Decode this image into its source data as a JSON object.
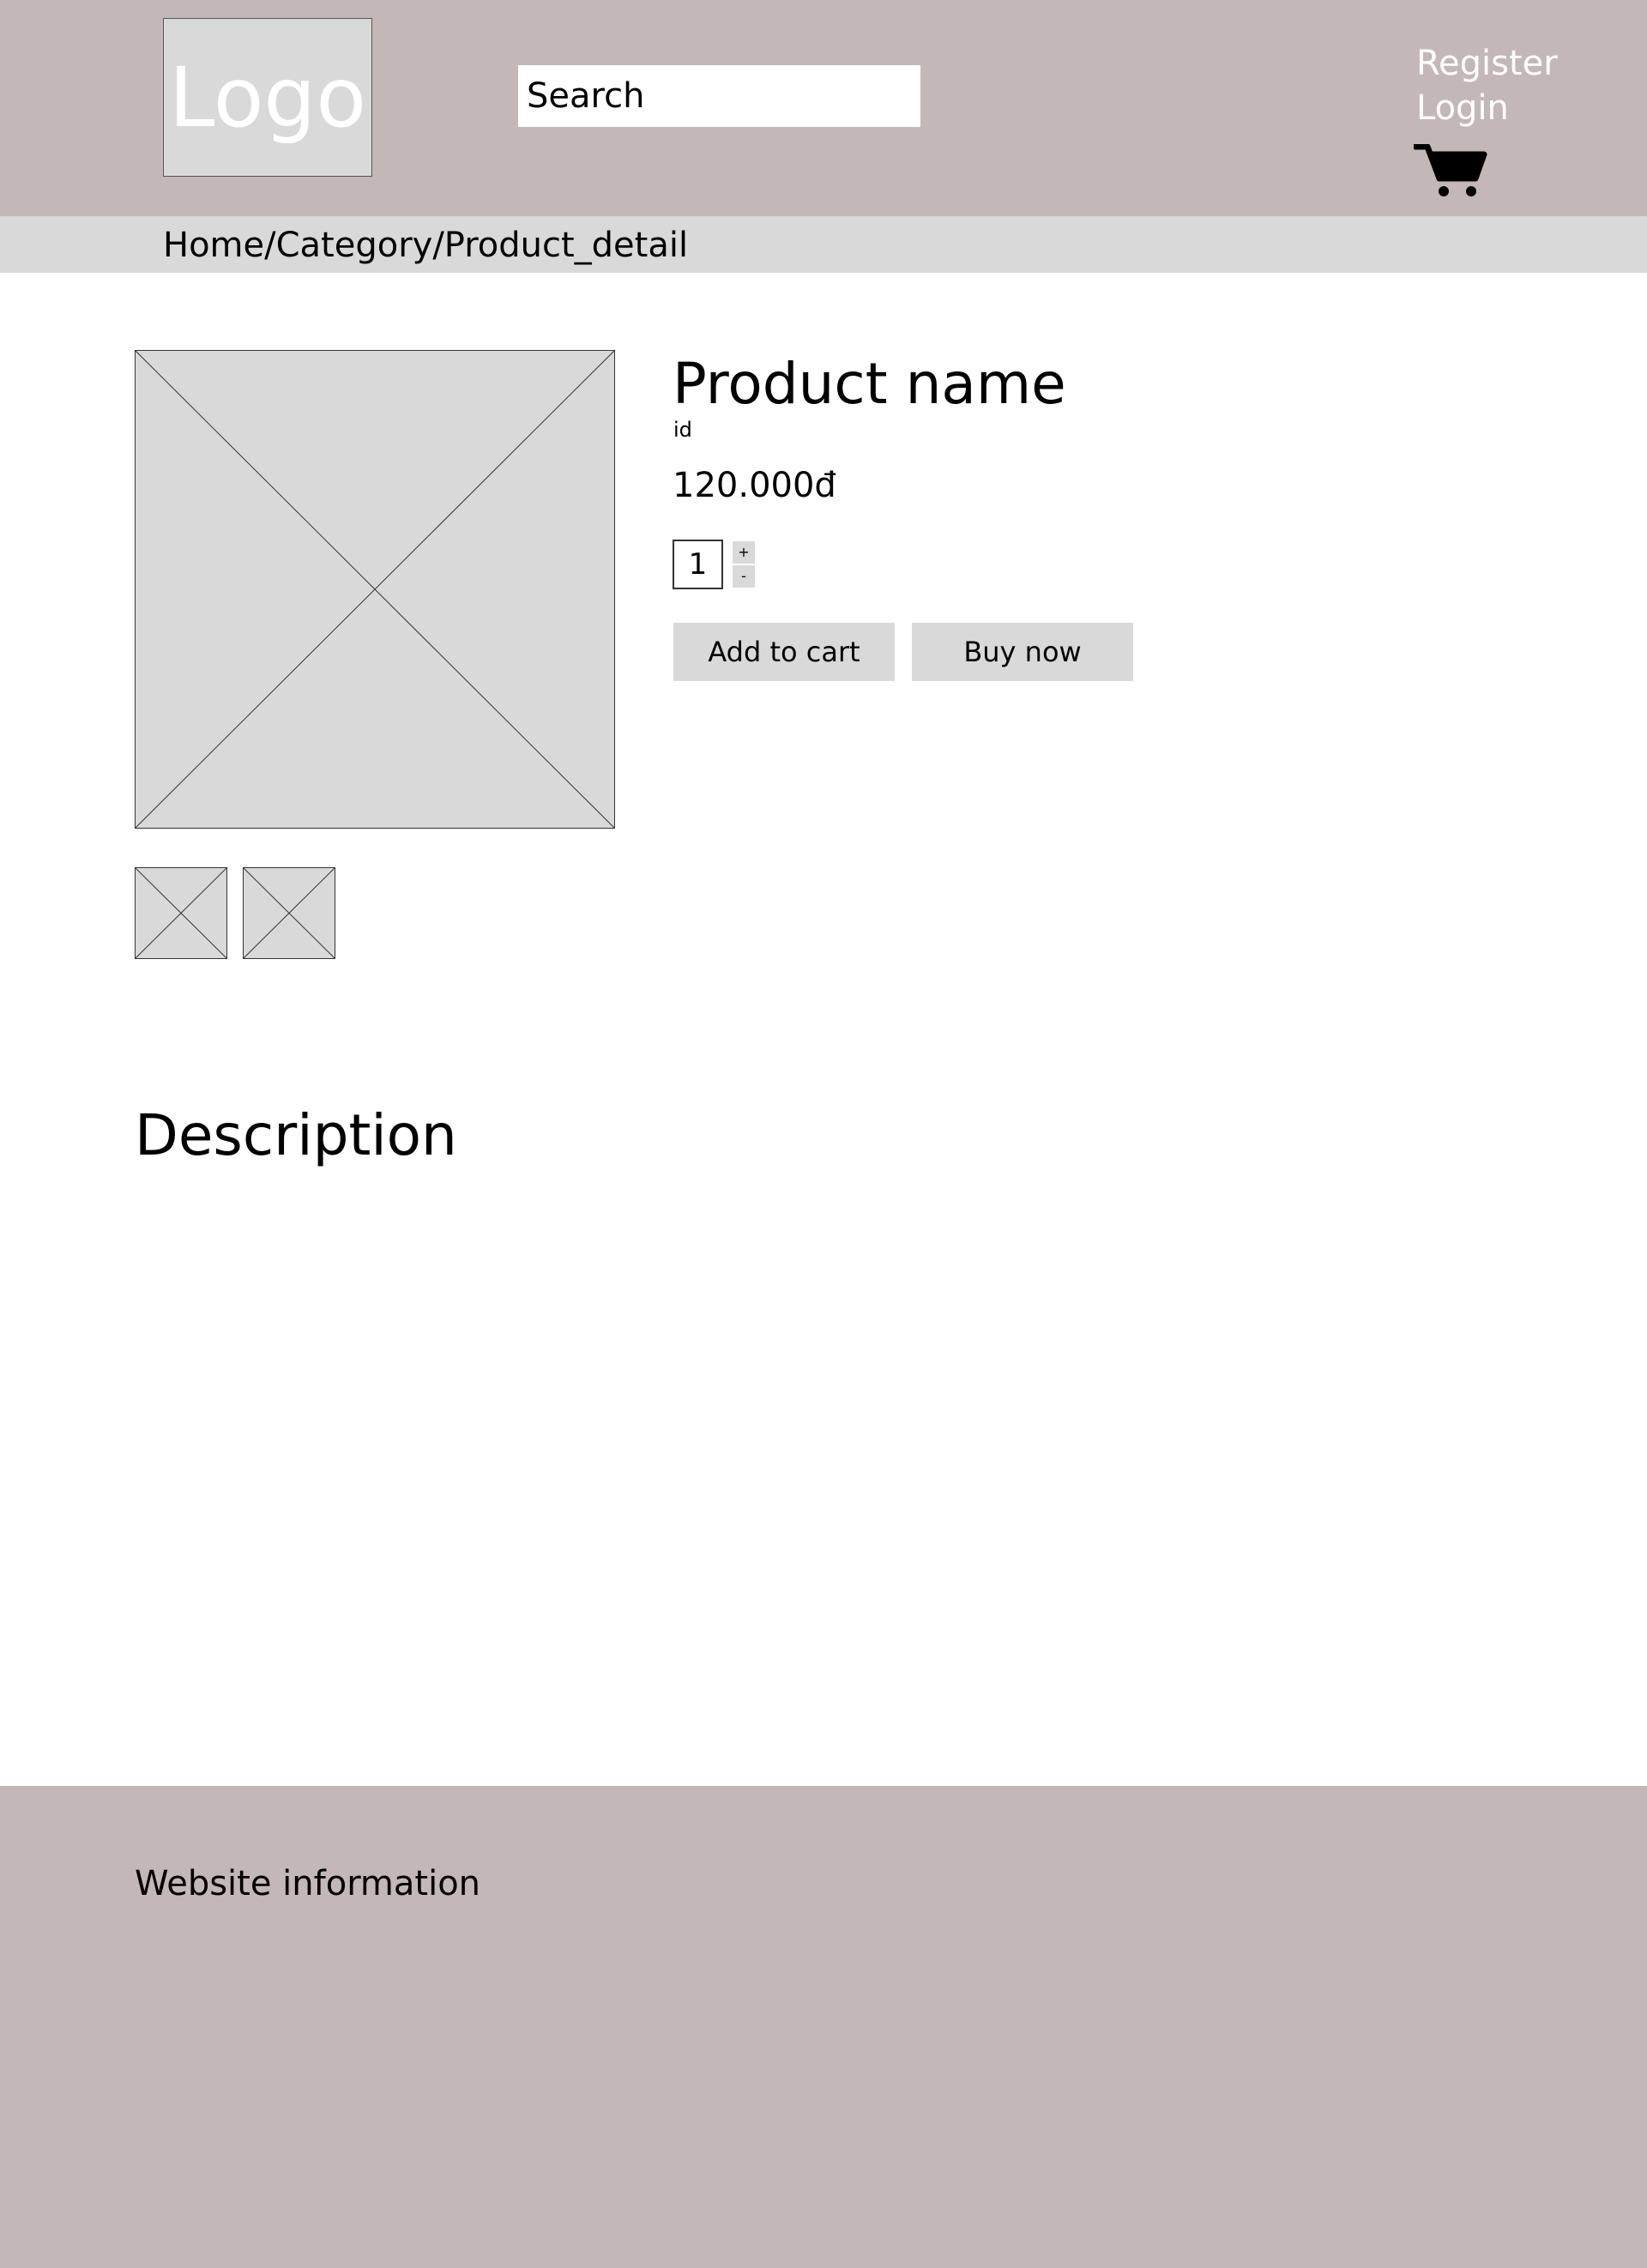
{
  "header": {
    "logo_text": "Logo",
    "search_placeholder": "Search",
    "register_label": "Register",
    "login_label": "Login",
    "cart_icon": "shopping-cart-icon"
  },
  "breadcrumb": {
    "text": "Home/Category/Product_detail"
  },
  "product": {
    "name": "Product name",
    "id": "id",
    "price": "120.000đ",
    "quantity": "1",
    "increment_label": "+",
    "decrement_label": "-",
    "add_to_cart_label": "Add to cart",
    "buy_now_label": "Buy now"
  },
  "description": {
    "title": "Description"
  },
  "footer": {
    "info": "Website information"
  },
  "colors": {
    "header_bg": "#c3b8b7",
    "breadcrumb_bg": "#d9d9d9",
    "placeholder_bg": "#d9d9d9",
    "footer_bg": "#c3b8b7"
  }
}
